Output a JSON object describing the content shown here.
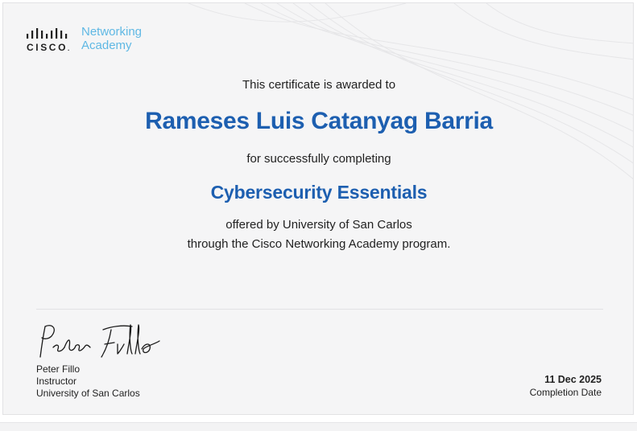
{
  "logo": {
    "wordmark": "CISCO",
    "academy_line1": "Networking",
    "academy_line2": "Academy"
  },
  "certificate": {
    "awarded_text": "This certificate is awarded to",
    "recipient_name": "Rameses Luis Catanyag Barria",
    "completing_text": "for successfully completing",
    "course_title": "Cybersecurity Essentials",
    "offered_by": "offered by University of San Carlos",
    "program_line": "through the Cisco Networking Academy program."
  },
  "signer": {
    "signature": "Peter Fillo",
    "name": "Peter Fillo",
    "role": "Instructor",
    "institution": "University of San Carlos"
  },
  "completion": {
    "date": "11 Dec 2025",
    "label": "Completion Date"
  },
  "colors": {
    "accent_blue": "#1d5fb0",
    "logo_blue": "#5fb8e4",
    "background": "#f5f5f6"
  }
}
